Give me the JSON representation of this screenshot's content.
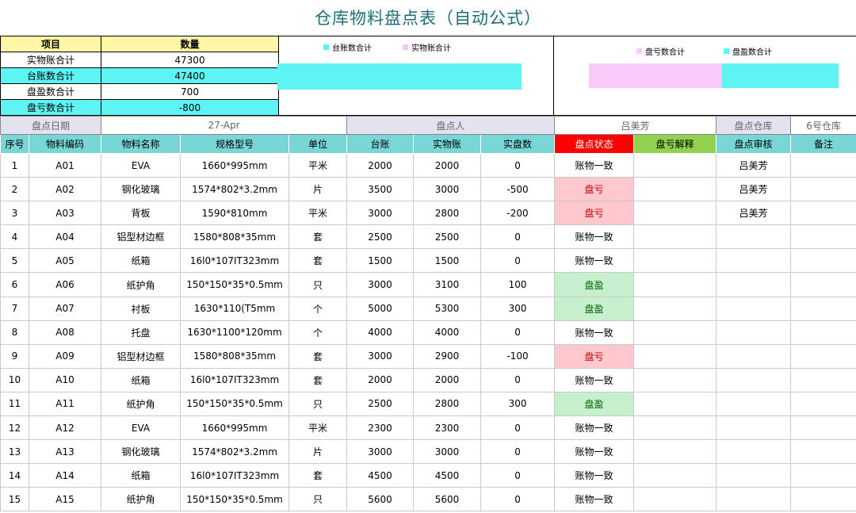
{
  "title": "仓库物料盘点表（自动公式）",
  "summary": {
    "header": [
      "项目",
      "数量"
    ],
    "rows": [
      {
        "label": "实物账合计",
        "value": "47300"
      },
      {
        "label": "台账数合计",
        "value": "47400"
      },
      {
        "label": "盘盈数合计",
        "value": "700"
      },
      {
        "label": "盘亏数合计",
        "value": "-800"
      }
    ]
  },
  "chart1": {
    "legend": [
      "台账数合计",
      "实物账合计"
    ],
    "colors": [
      "#5ff4f4",
      "#f5c6f5"
    ],
    "values": [
      47400,
      47300
    ]
  },
  "chart2": {
    "legend": [
      "盘亏数合计",
      "盘盈数合计"
    ],
    "colors": [
      "#f9c9f9",
      "#5ff4f4"
    ],
    "values": [
      -800,
      700
    ]
  },
  "info": {
    "date_label": "盘点日期",
    "date_value": "27-Apr",
    "person_label": "盘点人",
    "person_value": "吕美芳",
    "warehouse_label": "盘点仓库",
    "warehouse_value": "6号仓库"
  },
  "columns": [
    "序号",
    "物料编码",
    "物料名称",
    "规格型号",
    "单位",
    "台账",
    "实物账",
    "实盘数",
    "盘点状态",
    "盘亏解释",
    "盘点审核",
    "备注"
  ],
  "rows": [
    {
      "no": "1",
      "code": "A01",
      "name": "EVA",
      "spec": "1660*995mm",
      "unit": "平米",
      "ledger": "2000",
      "physical": "2000",
      "diff": "0",
      "status": "账物一致",
      "status_type": "ok",
      "explain": "",
      "audit": "吕美芳",
      "note": ""
    },
    {
      "no": "2",
      "code": "A02",
      "name": "钢化玻璃",
      "spec": "1574*802*3.2mm",
      "unit": "片",
      "ledger": "3500",
      "physical": "3000",
      "diff": "-500",
      "status": "盘亏",
      "status_type": "loss",
      "explain": "",
      "audit": "吕美芳",
      "note": ""
    },
    {
      "no": "3",
      "code": "A03",
      "name": "背板",
      "spec": "1590*810mm",
      "unit": "平米",
      "ledger": "3000",
      "physical": "2800",
      "diff": "-200",
      "status": "盘亏",
      "status_type": "loss",
      "explain": "",
      "audit": "吕美芳",
      "note": ""
    },
    {
      "no": "4",
      "code": "A04",
      "name": "铝型材边框",
      "spec": "1580*808*35mm",
      "unit": "套",
      "ledger": "2500",
      "physical": "2500",
      "diff": "0",
      "status": "账物一致",
      "status_type": "ok",
      "explain": "",
      "audit": "",
      "note": ""
    },
    {
      "no": "5",
      "code": "A05",
      "name": "纸箱",
      "spec": "16l0*107IT323mm",
      "unit": "套",
      "ledger": "1500",
      "physical": "1500",
      "diff": "0",
      "status": "账物一致",
      "status_type": "ok",
      "explain": "",
      "audit": "",
      "note": ""
    },
    {
      "no": "6",
      "code": "A06",
      "name": "纸护角",
      "spec": "150*150*35*0.5mm",
      "unit": "只",
      "ledger": "3000",
      "physical": "3100",
      "diff": "100",
      "status": "盘盈",
      "status_type": "gain",
      "explain": "",
      "audit": "",
      "note": ""
    },
    {
      "no": "7",
      "code": "A07",
      "name": "衬板",
      "spec": "1630*110(T5mm",
      "unit": "个",
      "ledger": "5000",
      "physical": "5300",
      "diff": "300",
      "status": "盘盈",
      "status_type": "gain",
      "explain": "",
      "audit": "",
      "note": ""
    },
    {
      "no": "8",
      "code": "A08",
      "name": "托盘",
      "spec": "1630*1100*120mm",
      "unit": "个",
      "ledger": "4000",
      "physical": "4000",
      "diff": "0",
      "status": "账物一致",
      "status_type": "ok",
      "explain": "",
      "audit": "",
      "note": ""
    },
    {
      "no": "9",
      "code": "A09",
      "name": "铝型材边框",
      "spec": "1580*808*35mm",
      "unit": "套",
      "ledger": "3000",
      "physical": "2900",
      "diff": "-100",
      "status": "盘亏",
      "status_type": "loss",
      "explain": "",
      "audit": "",
      "note": ""
    },
    {
      "no": "10",
      "code": "A10",
      "name": "纸箱",
      "spec": "16l0*107IT323mm",
      "unit": "套",
      "ledger": "2000",
      "physical": "2000",
      "diff": "0",
      "status": "账物一致",
      "status_type": "ok",
      "explain": "",
      "audit": "",
      "note": ""
    },
    {
      "no": "11",
      "code": "A11",
      "name": "纸护角",
      "spec": "150*150*35*0.5mm",
      "unit": "只",
      "ledger": "2500",
      "physical": "2800",
      "diff": "300",
      "status": "盘盈",
      "status_type": "gain",
      "explain": "",
      "audit": "",
      "note": ""
    },
    {
      "no": "12",
      "code": "A12",
      "name": "EVA",
      "spec": "1660*995mm",
      "unit": "平米",
      "ledger": "2300",
      "physical": "2300",
      "diff": "0",
      "status": "账物一致",
      "status_type": "ok",
      "explain": "",
      "audit": "",
      "note": ""
    },
    {
      "no": "13",
      "code": "A13",
      "name": "钢化玻璃",
      "spec": "1574*802*3.2mm",
      "unit": "片",
      "ledger": "3000",
      "physical": "3000",
      "diff": "0",
      "status": "账物一致",
      "status_type": "ok",
      "explain": "",
      "audit": "",
      "note": ""
    },
    {
      "no": "14",
      "code": "A14",
      "name": "纸箱",
      "spec": "16l0*107IT323mm",
      "unit": "套",
      "ledger": "4500",
      "physical": "4500",
      "diff": "0",
      "status": "账物一致",
      "status_type": "ok",
      "explain": "",
      "audit": "",
      "note": ""
    },
    {
      "no": "15",
      "code": "A15",
      "name": "纸护角",
      "spec": "150*150*35*0.5mm",
      "unit": "只",
      "ledger": "5600",
      "physical": "5600",
      "diff": "0",
      "status": "账物一致",
      "status_type": "ok",
      "explain": "",
      "audit": "",
      "note": ""
    }
  ]
}
